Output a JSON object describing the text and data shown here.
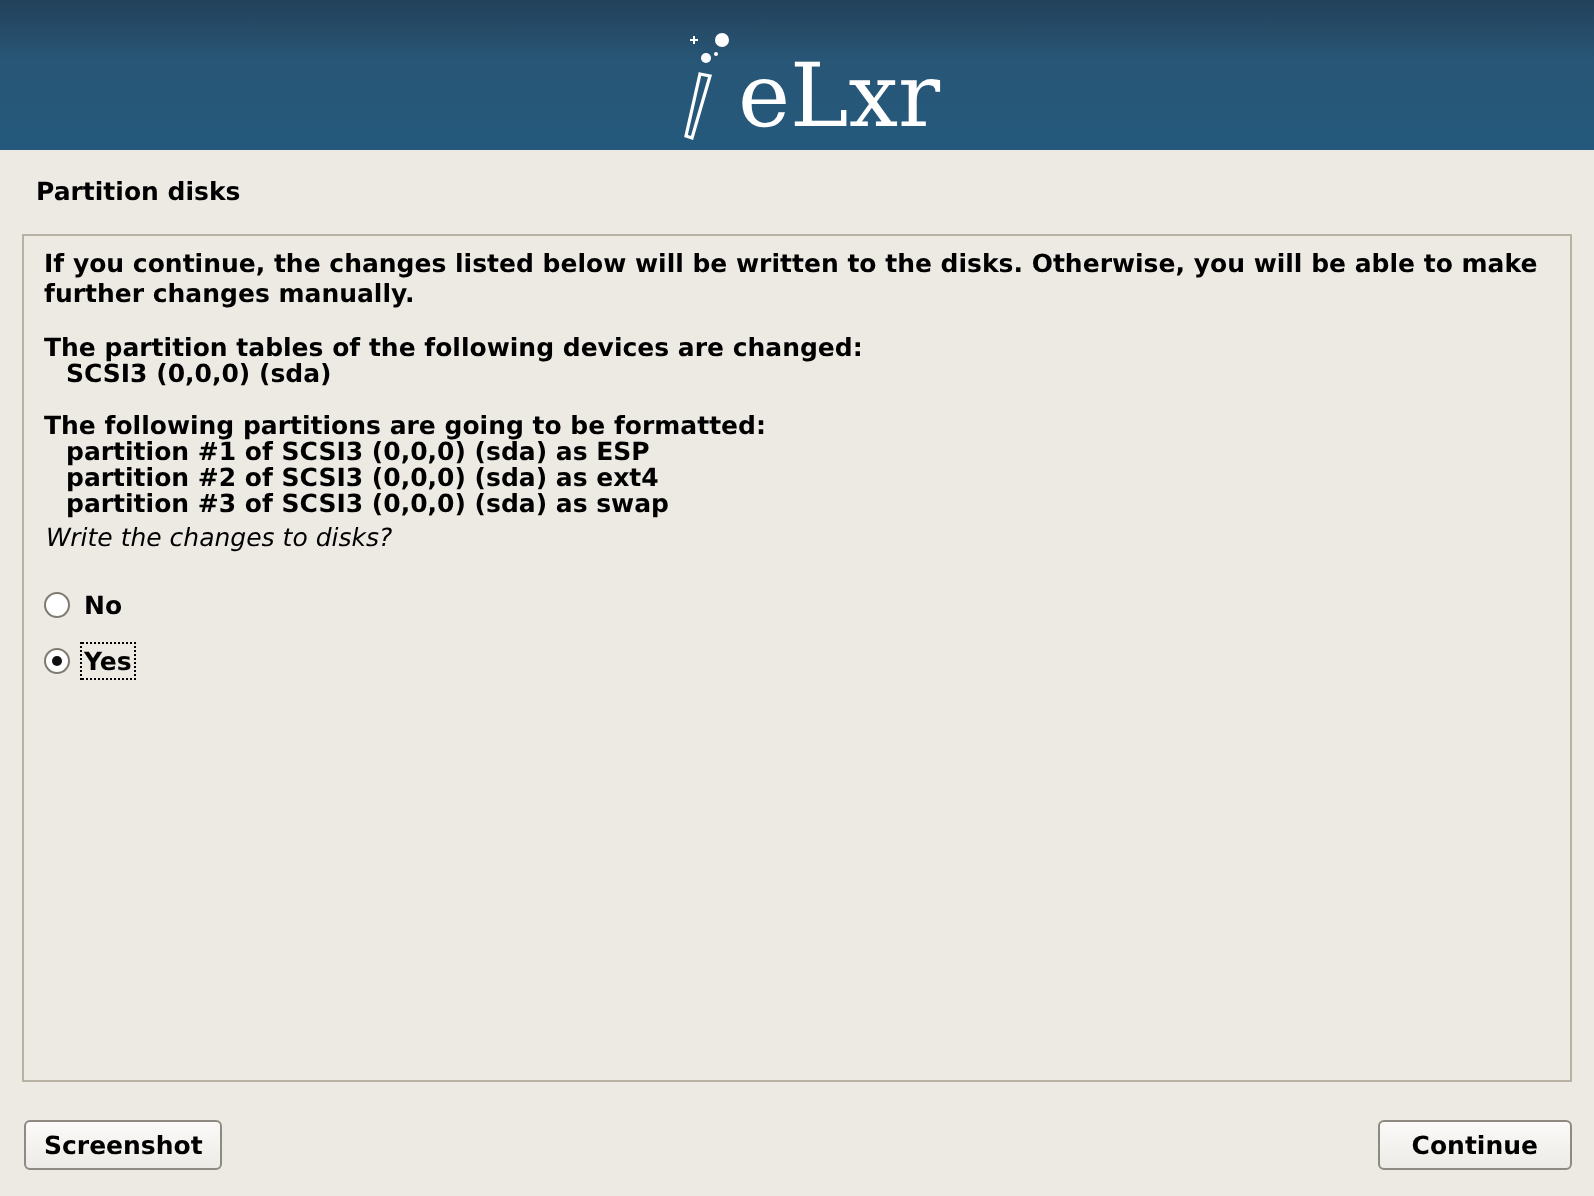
{
  "banner": {
    "logo": "eLxr"
  },
  "title": "Partition disks",
  "intro": "If you continue, the changes listed below will be written to the disks. Otherwise, you will be able to make further changes manually.",
  "sections": [
    {
      "heading": "The partition tables of the following devices are changed:",
      "items": [
        "SCSI3 (0,0,0) (sda)"
      ]
    },
    {
      "heading": "The following partitions are going to be formatted:",
      "items": [
        "partition #1 of SCSI3 (0,0,0) (sda) as ESP",
        "partition #2 of SCSI3 (0,0,0) (sda) as ext4",
        "partition #3 of SCSI3 (0,0,0) (sda) as swap"
      ]
    }
  ],
  "question": "Write the changes to disks?",
  "options": [
    {
      "label": "No",
      "selected": false
    },
    {
      "label": "Yes",
      "selected": true
    }
  ],
  "buttons": {
    "left": "Screenshot",
    "right": "Continue"
  }
}
